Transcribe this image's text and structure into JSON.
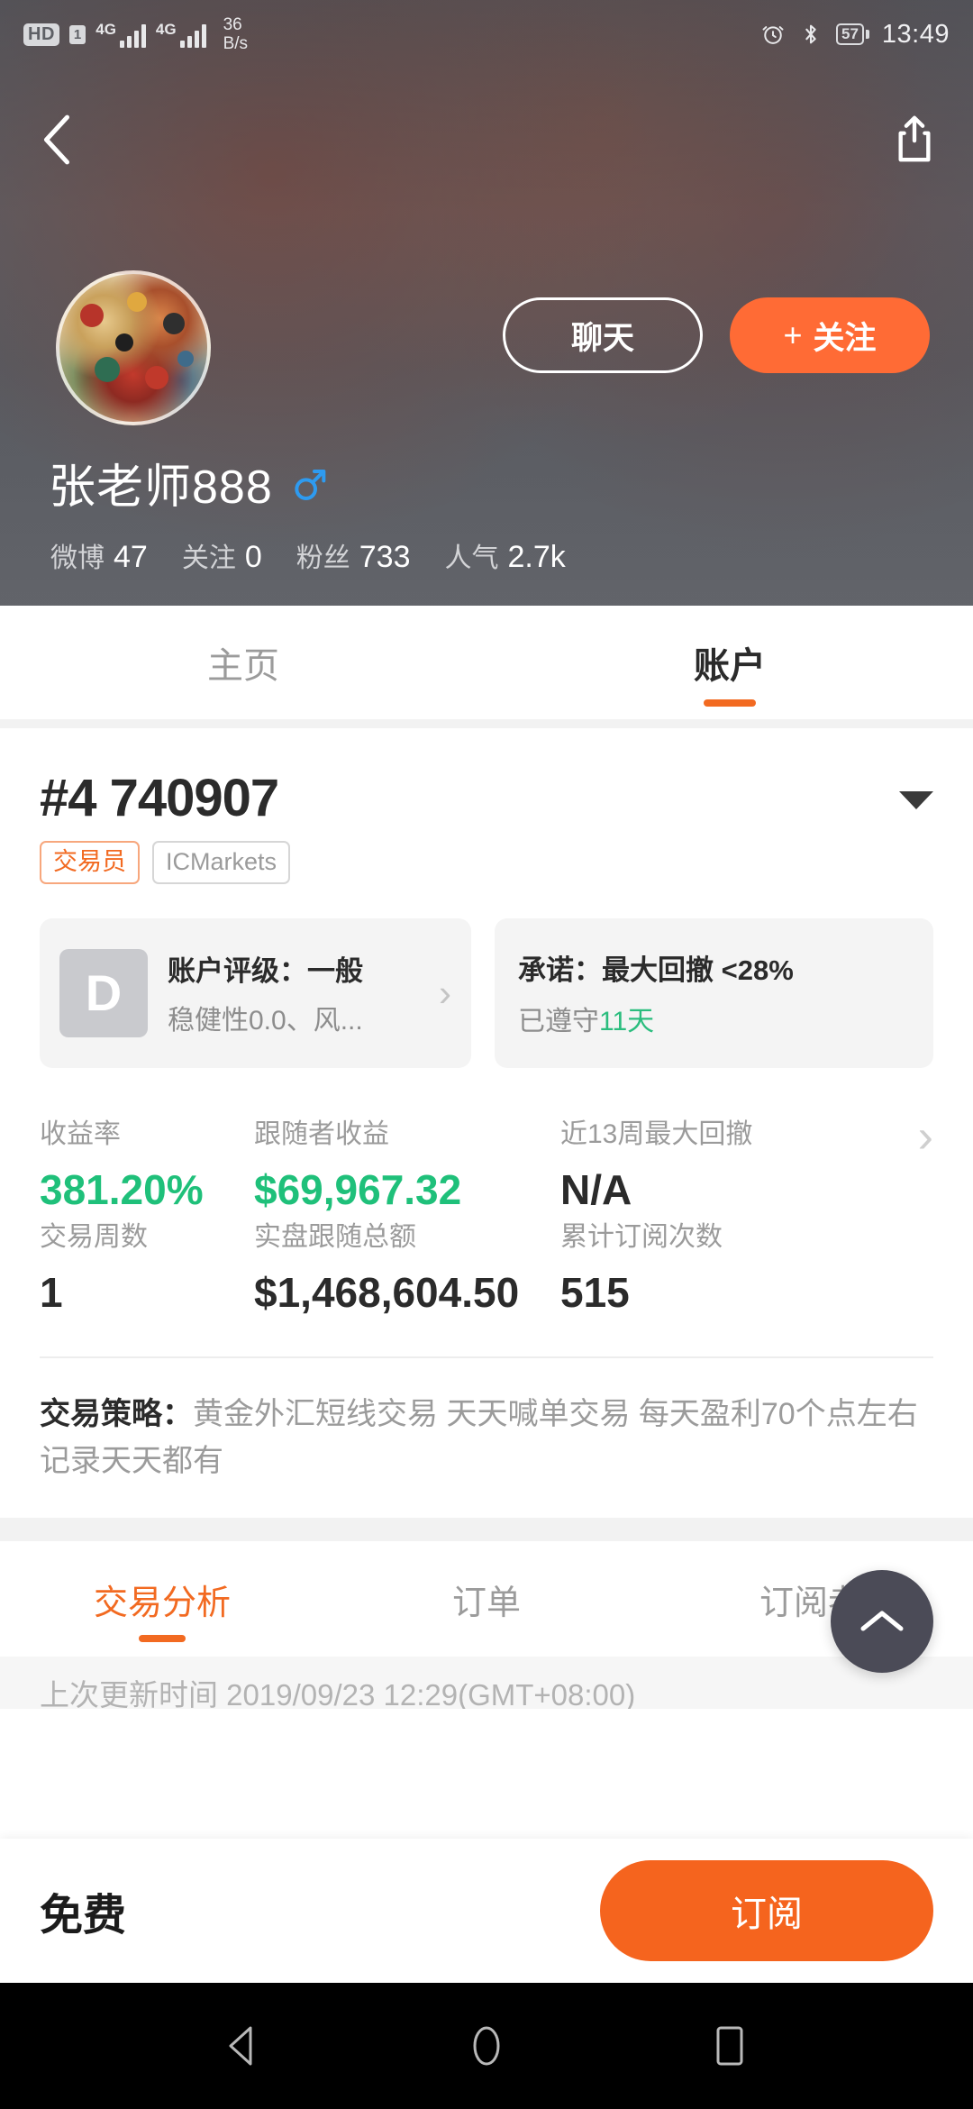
{
  "statusbar": {
    "hd": "HD",
    "sim": "1",
    "net1": "4G",
    "net2": "4G",
    "speed_value": "36",
    "speed_unit": "B/s",
    "alarm_icon": "alarm-clock-icon",
    "bluetooth_icon": "bluetooth-icon",
    "battery_level": "57",
    "time": "13:49"
  },
  "hero": {
    "back_icon": "back-chevron-icon",
    "share_icon": "share-icon",
    "avatar_alt": "user-avatar",
    "chat_button": "聊天",
    "follow_plus": "+",
    "follow_button": "关注",
    "name": "张老师888",
    "gender_icon": "male-gender-icon",
    "stats": [
      {
        "label": "微博",
        "value": "47"
      },
      {
        "label": "关注",
        "value": "0"
      },
      {
        "label": "粉丝",
        "value": "733"
      },
      {
        "label": "人气",
        "value": "2.7k"
      }
    ]
  },
  "primary_tabs": [
    {
      "label": "主页",
      "active": false
    },
    {
      "label": "账户",
      "active": true
    }
  ],
  "account": {
    "number": "#4 740907",
    "caret_icon": "chevron-down-icon",
    "badge_trader": "交易员",
    "badge_broker": "ICMarkets"
  },
  "rating_card": {
    "grade": "D",
    "title": "账户评级：一般",
    "subtitle": "稳健性0.0、风...",
    "chevron_icon": "chevron-right-icon"
  },
  "promise_card": {
    "title": "承诺：最大回撤 <28%",
    "sub_prefix": "已遵守",
    "sub_days": "11天"
  },
  "metrics": {
    "row1": [
      {
        "label": "收益率",
        "value": "381.20%",
        "color": "green"
      },
      {
        "label": "跟随者收益",
        "value": "$69,967.32",
        "color": "green"
      },
      {
        "label": "近13周最大回撤",
        "value": "N/A",
        "color": "dark"
      }
    ],
    "row2": [
      {
        "label": "交易周数",
        "value": "1",
        "color": "dark"
      },
      {
        "label": "实盘跟随总额",
        "value": "$1,468,604.50",
        "color": "dark"
      },
      {
        "label": "累计订阅次数",
        "value": "515",
        "color": "dark"
      }
    ],
    "chevron_icon": "chevron-right-icon"
  },
  "strategy": {
    "label": "交易策略：",
    "text": "黄金外汇短线交易 天天喊单交易  每天盈利70个点左右 记录天天都有"
  },
  "fab": {
    "icon": "chevron-up-icon"
  },
  "secondary_tabs": [
    {
      "label": "交易分析",
      "active": true
    },
    {
      "label": "订单",
      "active": false
    },
    {
      "label": "订阅者",
      "active": false
    }
  ],
  "update_strip": {
    "text": "上次更新时间 2019/09/23 12:29(GMT+08:00)"
  },
  "bottom_bar": {
    "price": "免费",
    "subscribe_button": "订阅"
  },
  "navbar": {
    "back_icon": "android-back-icon",
    "home_icon": "android-home-icon",
    "recents_icon": "android-recents-icon"
  },
  "colors": {
    "accent_orange": "#f26a21",
    "follow_orange": "#ff6b35",
    "subscribe_orange": "#f5641e",
    "green": "#1fc07a",
    "promise_green": "#2bbd7e",
    "text_dark": "#2b2b2b",
    "text_muted": "#9b9b9b"
  }
}
